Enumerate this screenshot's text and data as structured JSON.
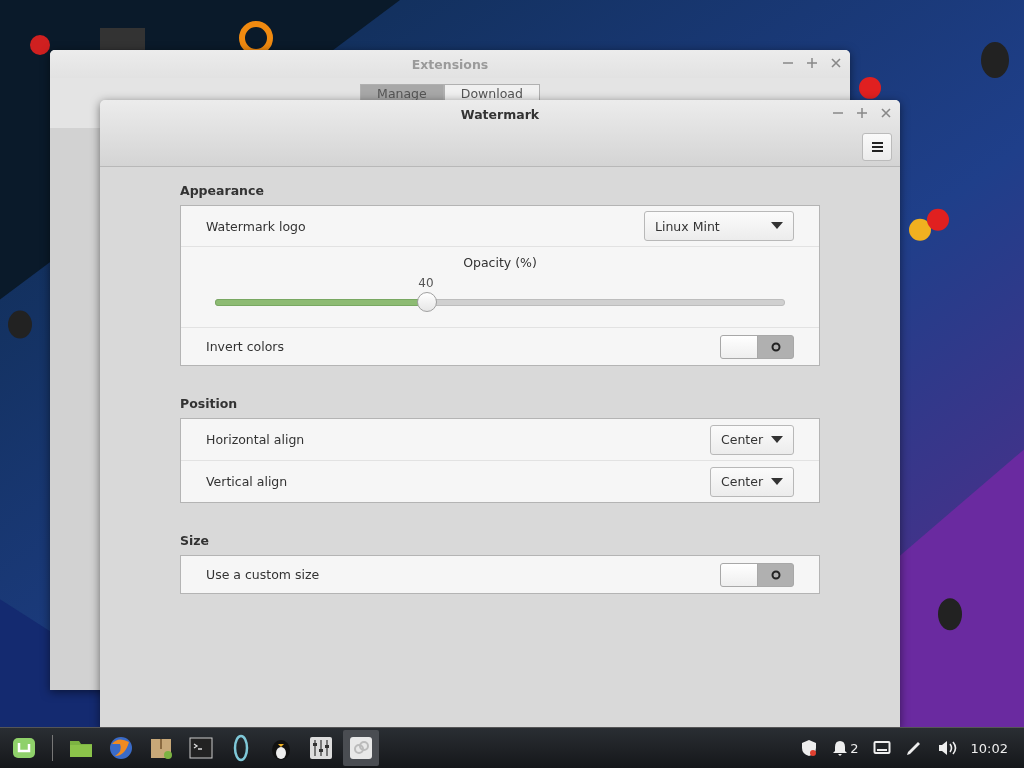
{
  "background_window": {
    "title": "Extensions",
    "tabs": [
      {
        "label": "Manage",
        "selected": true
      },
      {
        "label": "Download",
        "selected": false
      }
    ]
  },
  "window": {
    "title": "Watermark",
    "sections": [
      {
        "title": "Appearance",
        "rows": [
          {
            "kind": "dropdown",
            "label": "Watermark logo",
            "value": "Linux Mint"
          },
          {
            "kind": "slider",
            "label": "Opacity (%)",
            "reading": "40",
            "level": 0.37
          },
          {
            "kind": "switch",
            "label": "Invert colors",
            "on": false
          }
        ]
      },
      {
        "title": "Position",
        "rows": [
          {
            "kind": "dropdown",
            "label": "Horizontal align",
            "value": "Center"
          },
          {
            "kind": "dropdown",
            "label": "Vertical align",
            "value": "Center"
          }
        ]
      },
      {
        "title": "Size",
        "rows": [
          {
            "kind": "switch",
            "label": "Use a custom size",
            "on": false
          }
        ]
      }
    ]
  },
  "taskbar": {
    "notification_count": "2",
    "clock": "10:02"
  }
}
